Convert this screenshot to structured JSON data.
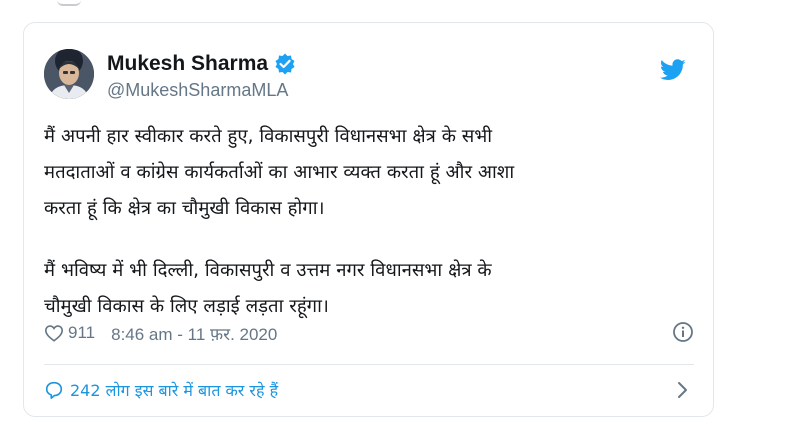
{
  "tweet": {
    "author": {
      "display_name": "Mukesh Sharma",
      "handle": "@MukeshSharmaMLA",
      "verified": true,
      "avatar_icon": "avatar-photo"
    },
    "brand_icon": "twitter-bird-icon",
    "text_lines": [
      "मैं अपनी हार स्वीकार करते हुए, विकासपुरी विधानसभा क्षेत्र के सभी",
      "मतदाताओं व कांग्रेस कार्यकर्ताओं का आभार व्यक्त करता हूं और आशा",
      "करता हूं कि क्षेत्र का चौमुखी विकास होगा।",
      "मैं भविष्य में भी दिल्ली, विकासपुरी व उत्तम नगर विधानसभा क्षेत्र के",
      "चौमुखी विकास के लिए लड़ाई लड़ता रहूंगा।"
    ],
    "likes": "911",
    "timestamp": "8:46 am - 11 फ़र. 2020",
    "conversation_label": "242 लोग इस बारे में बात कर रहे हैं"
  },
  "colors": {
    "accent": "#1da1f2",
    "link": "#1b95e0",
    "secondary_text": "#657786",
    "border": "#e1e8ed"
  }
}
